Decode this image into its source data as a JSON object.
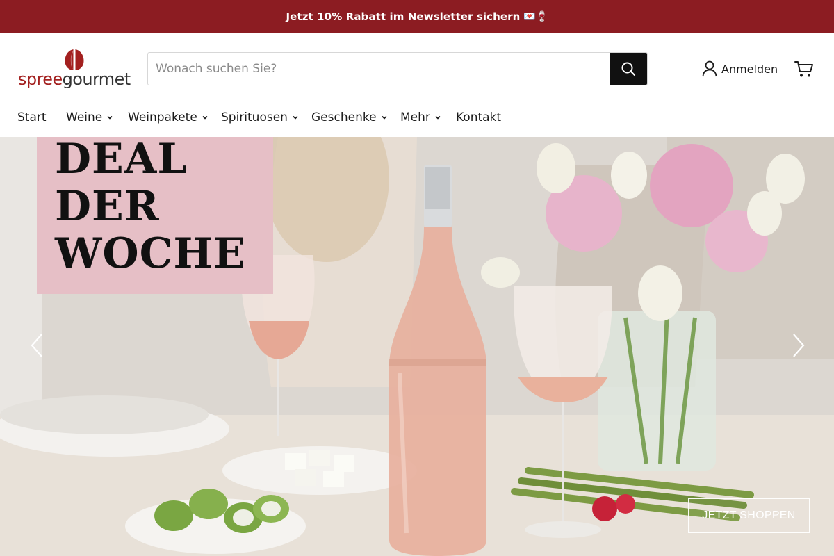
{
  "announcement": {
    "text": "Jetzt 10% Rabatt im Newsletter sichern",
    "emojis": "💌🍷"
  },
  "logo": {
    "brand_part1": "spree",
    "brand_part2": "gourmet",
    "brand_color": "#a3201f"
  },
  "search": {
    "placeholder": "Wonach suchen Sie?",
    "value": "",
    "icon": "search-icon"
  },
  "account": {
    "label": "Anmelden",
    "icon": "user-icon"
  },
  "cart": {
    "icon": "cart-icon"
  },
  "nav": {
    "items": [
      {
        "label": "Start",
        "has_dropdown": false
      },
      {
        "label": "Weine",
        "has_dropdown": true
      },
      {
        "label": "Weinpakete",
        "has_dropdown": true
      },
      {
        "label": "Spirituosen",
        "has_dropdown": true
      },
      {
        "label": "Geschenke",
        "has_dropdown": true
      },
      {
        "label": "Mehr",
        "has_dropdown": true
      },
      {
        "label": "Kontakt",
        "has_dropdown": false
      }
    ]
  },
  "hero": {
    "deal_lines": [
      "DEAL",
      "DER",
      "WOCHE"
    ],
    "cta_label": "JETZT SHOPPEN",
    "prev_icon": "chevron-left-icon",
    "next_icon": "chevron-right-icon"
  },
  "colors": {
    "announcement_bg": "#8c1c22",
    "deal_box_bg": "#e6bfc6",
    "search_button_bg": "#111111"
  }
}
